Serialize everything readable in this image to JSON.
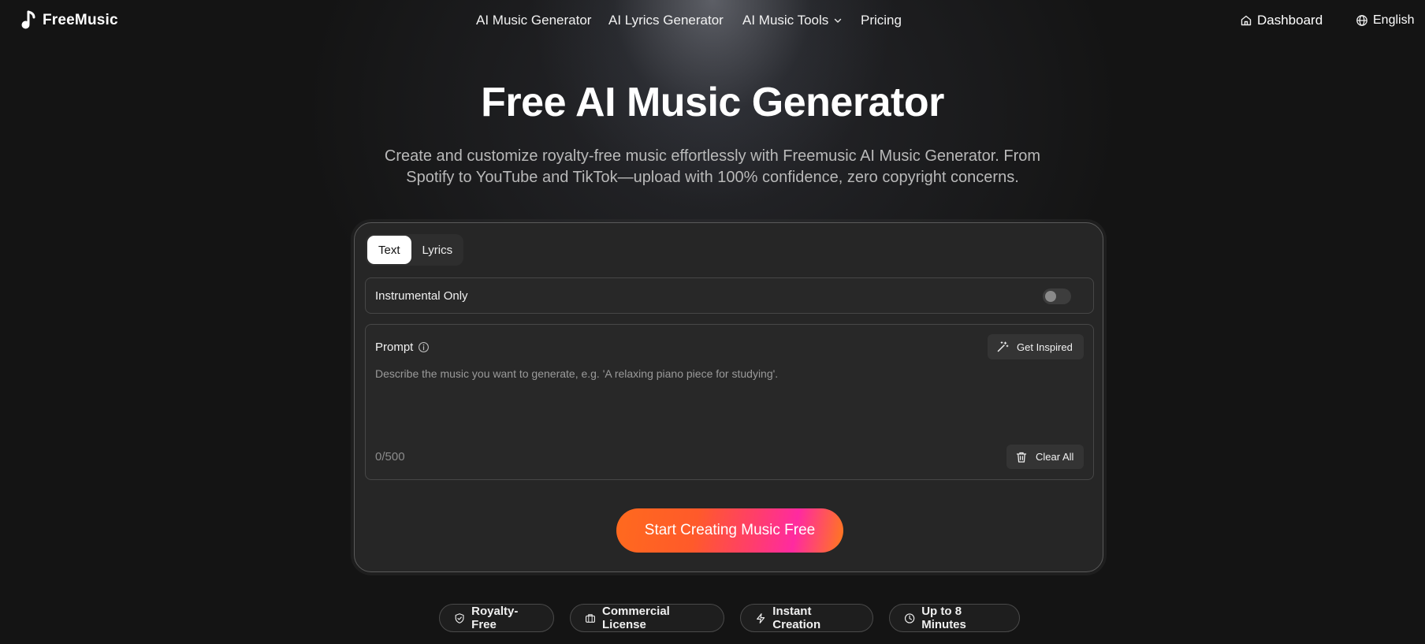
{
  "brand": {
    "name": "FreeMusic",
    "icon": "music-note-icon"
  },
  "nav": {
    "links": [
      "AI Music Generator",
      "AI Lyrics Generator",
      "AI Music Tools",
      "Pricing"
    ],
    "tools_icon": "chevron-down-icon",
    "dashboard": "Dashboard",
    "dashboard_icon": "home-icon",
    "language": "English",
    "language_icon": "globe-icon"
  },
  "hero": {
    "title": "Free AI Music Generator",
    "subtitle": "Create and customize royalty-free music effortlessly with Freemusic AI Music Generator. From Spotify to YouTube and TikTok—upload with 100% confidence, zero copyright concerns."
  },
  "generator": {
    "tabs": [
      "Text",
      "Lyrics"
    ],
    "active_tab": "Text",
    "instrumental_label": "Instrumental Only",
    "instrumental_on": false,
    "prompt_label": "Prompt",
    "get_inspired": "Get Inspired",
    "prompt_placeholder": "Describe the music you want to generate, e.g. 'A relaxing piano piece for studying'.",
    "prompt_value": "",
    "counter": "0/500",
    "clear_all": "Clear All",
    "cta": "Start Creating Music Free"
  },
  "features": [
    {
      "label": "Royalty-Free",
      "icon": "shield-check-icon"
    },
    {
      "label": "Commercial License",
      "icon": "briefcase-icon"
    },
    {
      "label": "Instant Creation",
      "icon": "lightning-icon"
    },
    {
      "label": "Up to 8 Minutes",
      "icon": "clock-icon"
    }
  ],
  "colors": {
    "background": "#141414",
    "card": "#262626",
    "cta_gradient_start": "#ff6a1e",
    "cta_gradient_mid": "#ff2aa0"
  }
}
